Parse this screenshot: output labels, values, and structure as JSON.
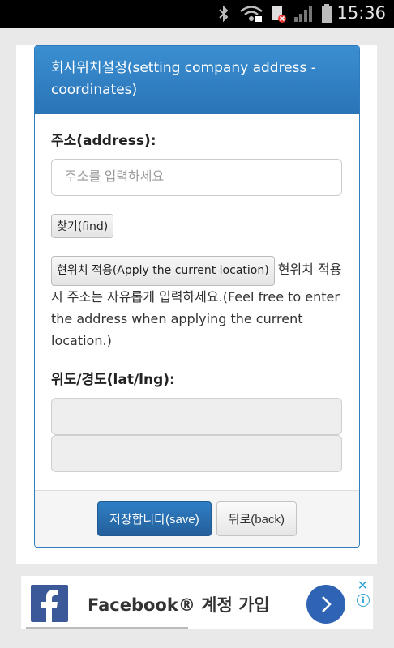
{
  "status_bar": {
    "time": "15:36",
    "icons": [
      "bluetooth-icon",
      "wifi-icon",
      "sim-error-icon",
      "signal-icon",
      "battery-icon"
    ]
  },
  "form": {
    "title": "회사위치설정(setting company address - coordinates)",
    "address_label": "주소(address):",
    "address_placeholder": "주소를 입력하세요",
    "find_button": "찾기(find)",
    "apply_button": "현위치 적용(Apply the current location)",
    "apply_note": "현위치 적용시 주소는 자유롭게 입력하세요.(Feel free to enter the address when applying the current location.)",
    "latlng_label": "위도/경도(lat/lng):",
    "save_button": "저장합니다(save)",
    "back_button": "뒤로(back)"
  },
  "ad": {
    "text": "Facebook® 계정 가입",
    "icons": [
      "facebook-logo-icon",
      "arrow-right-icon",
      "close-icon",
      "info-icon"
    ]
  },
  "colors": {
    "header_blue": "#2a73b7",
    "primary_button": "#245f9a",
    "facebook_blue": "#3b5998"
  }
}
